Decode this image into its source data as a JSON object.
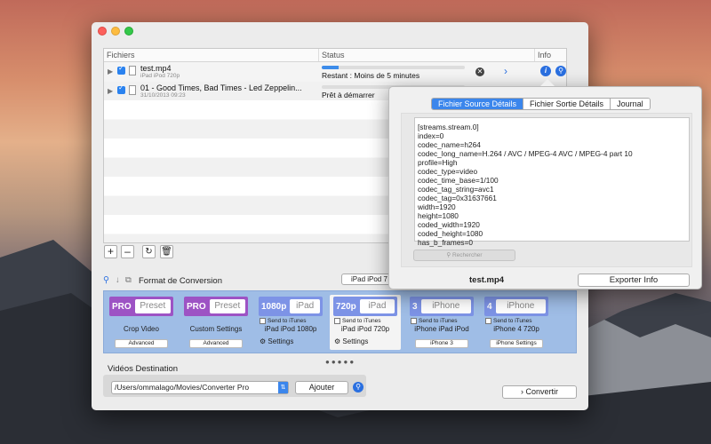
{
  "list": {
    "headers": [
      "Fichiers",
      "Status",
      "Info"
    ],
    "rows": [
      {
        "name": "test.mp4",
        "sub": "iPad iPod 720p",
        "progress": 0.12,
        "status": "Restant : Moins de 5 minutes"
      },
      {
        "name": "01 - Good Times, Bad Times - Led Zeppelin...",
        "sub": "31/10/2013 09:23",
        "progress": 0.0,
        "status": "Prêt à démarrer"
      }
    ]
  },
  "format": {
    "title": "Format de Conversion",
    "behind_tab": "iPad iPod 7",
    "cards": [
      {
        "badge": "PRO",
        "box": "Preset",
        "color": "#9d53c4",
        "name": "Crop Video",
        "button": "Advanced"
      },
      {
        "badge": "PRO",
        "box": "Preset",
        "color": "#9d53c4",
        "name": "Custom Settings",
        "button": "Advanced"
      },
      {
        "badge": "1080p",
        "box": "iPad",
        "color": "#7d93e6",
        "itunes": "Send to iTunes",
        "name": "iPad iPod 1080p",
        "settings": "Settings"
      },
      {
        "badge": "720p",
        "box": "iPad",
        "color": "#7d93e6",
        "itunes": "Send to iTunes",
        "name": "iPad iPod 720p",
        "settings": "Settings"
      },
      {
        "badge": "3",
        "box": "iPhone",
        "color": "#7d93e6",
        "itunes": "Send to iTunes",
        "name": "iPhone iPad iPod",
        "button": "iPhone 3"
      },
      {
        "badge": "4",
        "box": "iPhone",
        "color": "#7d93e6",
        "itunes": "Send to iTunes",
        "name": "iPhone 4 720p",
        "button": "iPhone Settings"
      }
    ]
  },
  "destination": {
    "title": "Vidéos Destination",
    "path": "/Users/ommalago/Movies/Converter Pro",
    "add": "Ajouter"
  },
  "convert": "Convertir",
  "popover": {
    "tabs": [
      "Fichier Source Détails",
      "Fichier Sortie Détails",
      "Journal"
    ],
    "details": "[streams.stream.0]\nindex=0\ncodec_name=h264\ncodec_long_name=H.264 / AVC / MPEG-4 AVC / MPEG-4 part 10\nprofile=High\ncodec_type=video\ncodec_time_base=1/100\ncodec_tag_string=avc1\ncodec_tag=0x31637661\nwidth=1920\nheight=1080\ncoded_width=1920\ncoded_height=1080\nhas_b_frames=0",
    "search": "Rechercher",
    "file": "test.mp4",
    "export": "Exporter Info"
  }
}
